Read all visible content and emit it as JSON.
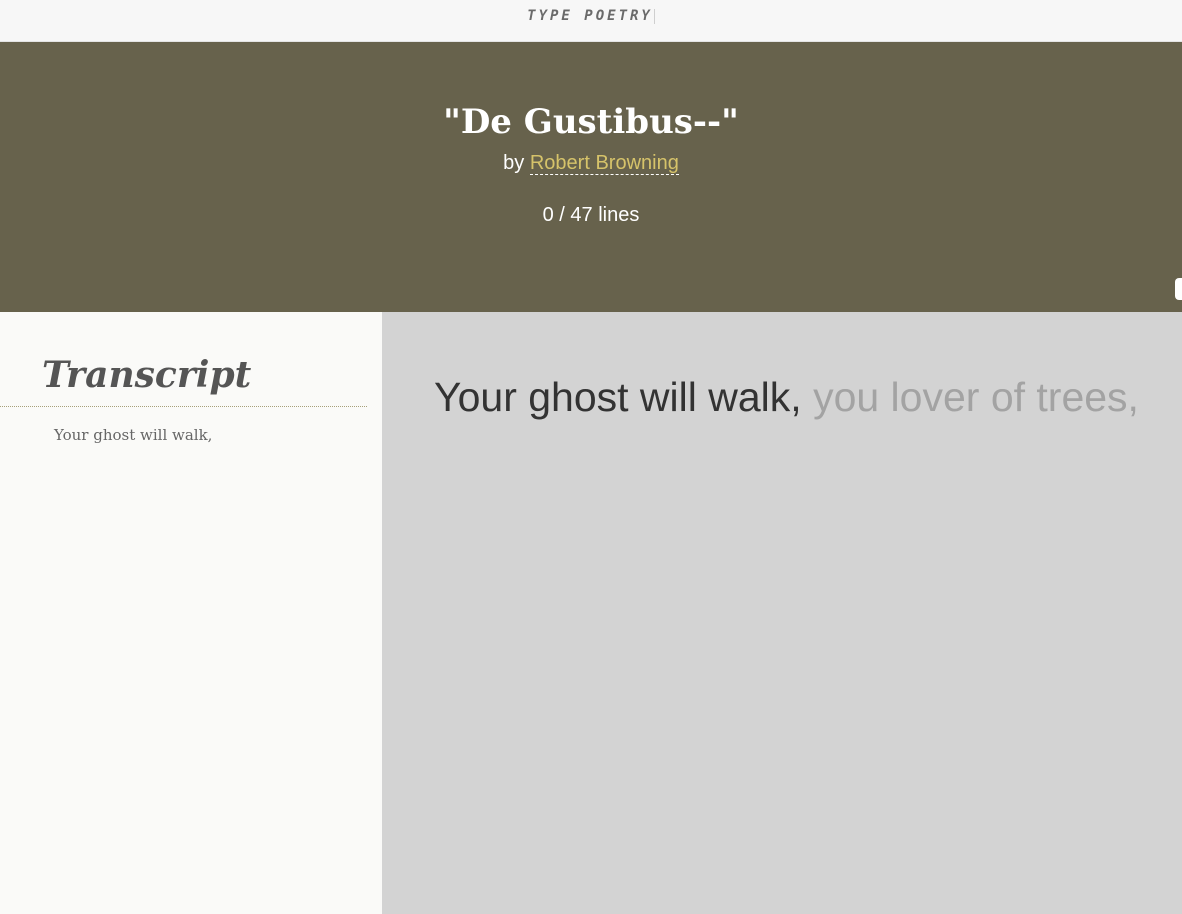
{
  "header": {
    "brand": "TYPE POETRY"
  },
  "poem": {
    "title": "\"De Gustibus--\"",
    "by_prefix": "by",
    "author": "Robert Browning",
    "progress_text": "0 / 47 lines"
  },
  "sidebar": {
    "title": "Transcript",
    "lines": [
      "Your ghost will walk,"
    ]
  },
  "typing": {
    "typed": "Your ghost will walk, ",
    "remaining": "you lover of trees,"
  },
  "colors": {
    "hero_bg": "#67624c",
    "author_link": "#d6c36a",
    "typing_bg": "#d3d3d3",
    "typed_text": "#333333",
    "untyped_text": "#a3a3a3"
  }
}
